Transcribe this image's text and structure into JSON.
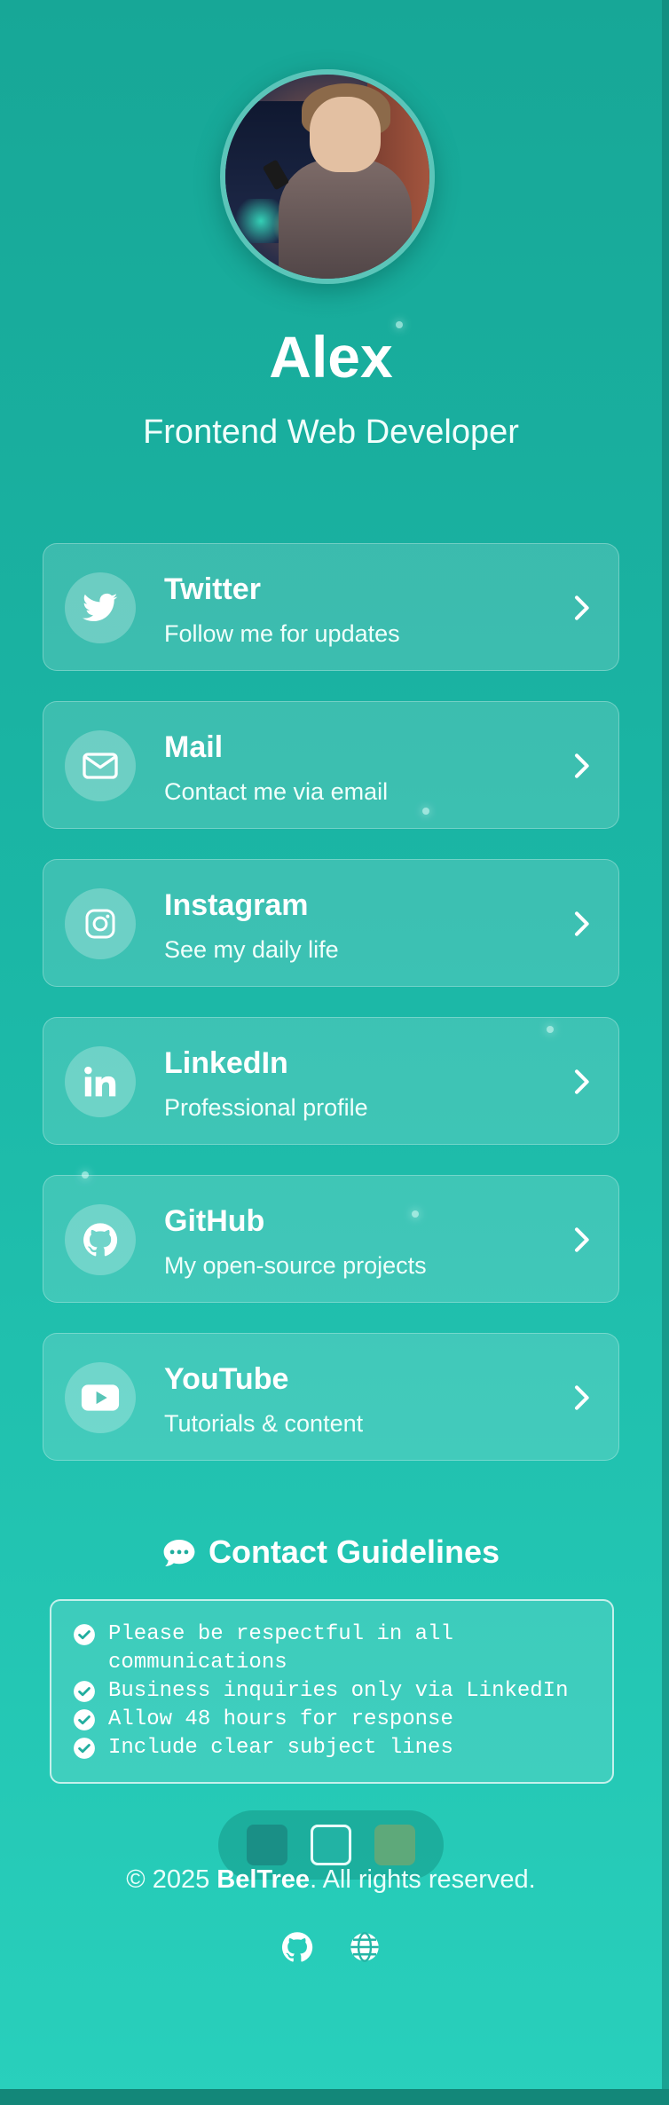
{
  "profile": {
    "name": "Alex",
    "role": "Frontend Web Developer"
  },
  "links": [
    {
      "title": "Twitter",
      "subtitle": "Follow me for updates",
      "icon": "twitter-icon"
    },
    {
      "title": "Mail",
      "subtitle": "Contact me via email",
      "icon": "mail-icon"
    },
    {
      "title": "Instagram",
      "subtitle": "See my daily life",
      "icon": "instagram-icon"
    },
    {
      "title": "LinkedIn",
      "subtitle": "Professional profile",
      "icon": "linkedin-icon"
    },
    {
      "title": "GitHub",
      "subtitle": "My open-source projects",
      "icon": "github-icon"
    },
    {
      "title": "YouTube",
      "subtitle": "Tutorials & content",
      "icon": "youtube-icon"
    }
  ],
  "guidelines": {
    "title": "Contact Guidelines",
    "items": [
      "Please be respectful in all communications",
      "Business inquiries only via LinkedIn",
      "Allow 48 hours for response",
      "Include clear subject lines"
    ]
  },
  "theme_swatches": [
    {
      "color": "#1a8f86",
      "selected": false
    },
    {
      "color": "#22b3a4",
      "selected": true
    },
    {
      "color": "#5ea97a",
      "selected": false
    }
  ],
  "footer": {
    "copyright_prefix": "© 2025 ",
    "brand": "BelTree",
    "copyright_suffix": ". All rights reserved.",
    "icons": [
      "github-icon",
      "globe-icon"
    ]
  },
  "colors": {
    "bg_top": "#17a797",
    "bg_bottom": "#29d0bc",
    "card_bg": "rgba(255,255,255,0.15)"
  }
}
